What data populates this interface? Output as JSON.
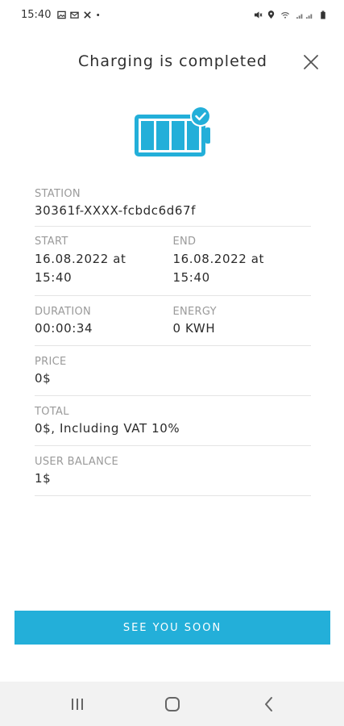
{
  "status_bar": {
    "time": "15:40",
    "left_icons": [
      "image-icon",
      "mail-icon",
      "tools-icon",
      "dot-icon"
    ],
    "right_icons": [
      "mute-icon",
      "location-icon",
      "wifi-icon",
      "signal-icon",
      "battery-status-icon"
    ]
  },
  "header": {
    "title": "Charging is completed",
    "close_icon": "close-icon"
  },
  "illustration": {
    "icon": "battery-check-icon",
    "color": "#23afd9"
  },
  "details": {
    "station": {
      "label": "STATION",
      "value": "30361f-XXXX-fcbdc6d67f"
    },
    "start": {
      "label": "START",
      "value_line1": "16.08.2022 at",
      "value_line2": "15:40"
    },
    "end": {
      "label": "END",
      "value_line1": "16.08.2022 at",
      "value_line2": "15:40"
    },
    "duration": {
      "label": "DURATION",
      "value": "00:00:34"
    },
    "energy": {
      "label": "ENERGY",
      "value": "0 KWH"
    },
    "price": {
      "label": "PRICE",
      "value": "0$"
    },
    "total": {
      "label": "TOTAL",
      "value": "0$, Including VAT 10%"
    },
    "user_balance": {
      "label": "USER BALANCE",
      "value": "1$"
    }
  },
  "actions": {
    "primary_label": "SEE YOU SOON",
    "primary_color": "#23afd9"
  },
  "nav_bar": {
    "items": [
      "recent-apps-icon",
      "home-icon",
      "back-icon"
    ]
  }
}
